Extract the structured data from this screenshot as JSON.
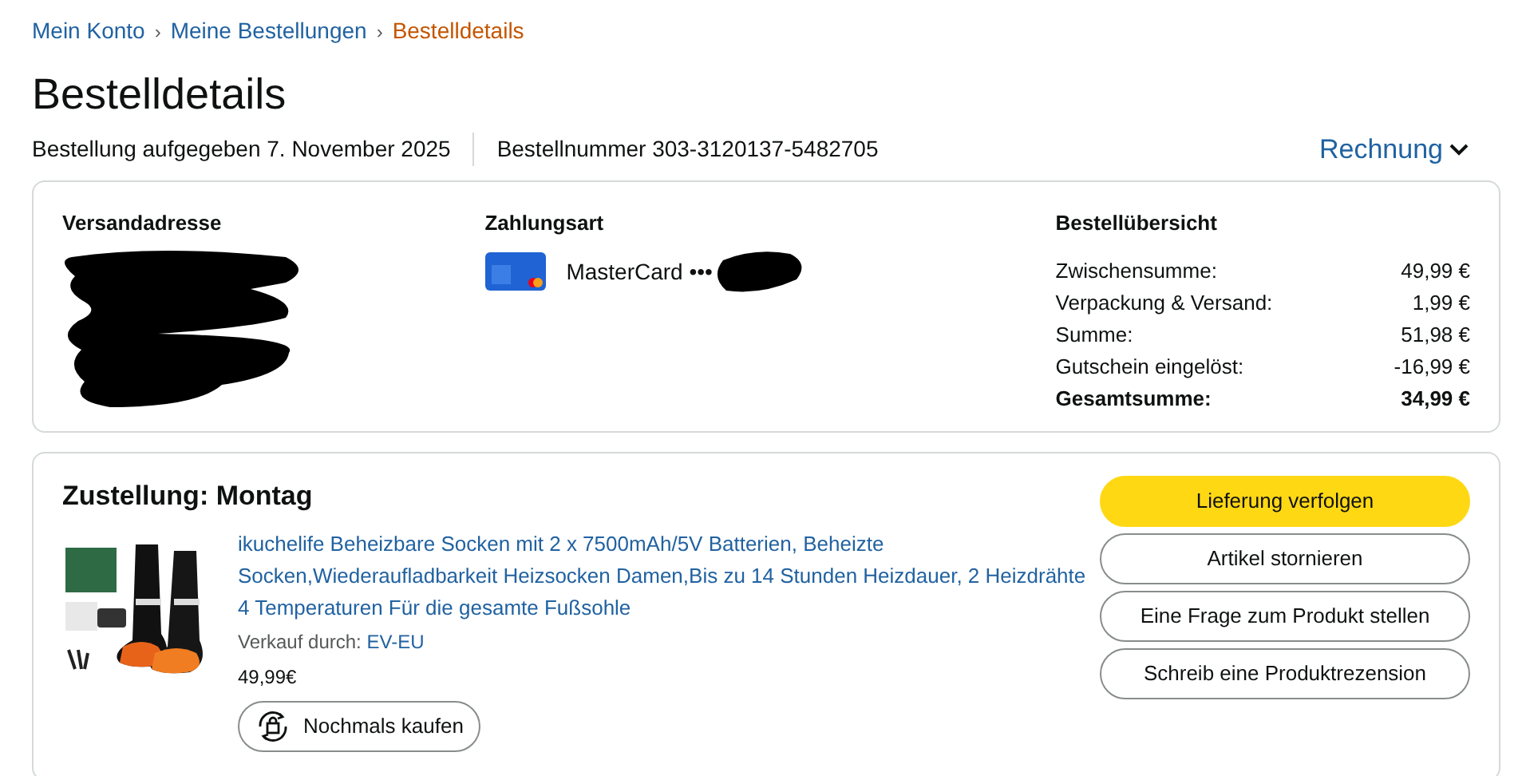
{
  "breadcrumb": [
    {
      "label": "Mein Konto",
      "selected": false
    },
    {
      "separator": "›",
      "label": "Meine Bestellungen",
      "selected": false
    },
    {
      "separator": "›",
      "label": "Bestelldetails",
      "selected": true
    }
  ],
  "title": "Bestelldetails",
  "order_info": [
    "Bestellung aufgegeben 7. November 2025",
    "Bestellnummer 303-3120137-5482705"
  ],
  "invoice_link": "Rechnung",
  "shipping": {
    "heading": "Versandadresse"
  },
  "payment": {
    "heading": "Zahlungsart",
    "card": "MasterCard •••"
  },
  "summary": {
    "heading": "Bestellübersicht",
    "rows": [
      {
        "label": "Zwischensumme:",
        "value": "49,99 €",
        "total": false
      },
      {
        "label": "Verpackung & Versand:",
        "value": "1,99 €",
        "total": false
      },
      {
        "label": "Summe:",
        "value": "51,98 €",
        "total": false
      },
      {
        "label": "Gutschein eingelöst:",
        "value": "-16,99 €",
        "total": false
      },
      {
        "label": "Gesamtsumme:",
        "value": "34,99 €",
        "total": true
      }
    ]
  },
  "delivery": {
    "heading": "Zustellung: Montag",
    "product": {
      "title": "ikuchelife Beheizbare Socken mit 2 x 7500mAh/5V Batterien, Beheizte Socken,Wiederaufladbarkeit Heizsocken Damen,Bis zu 14 Stunden Heizdauer, 2 Heizdrähte 4 Temperaturen Für die gesamte Fußsohle",
      "seller_label": "Verkauf durch:",
      "seller": "EV-EU",
      "price": "49,99€",
      "rebuy": "Nochmals kaufen"
    },
    "actions": [
      {
        "label": "Lieferung verfolgen",
        "kind": "primary"
      },
      {
        "label": "Artikel stornieren",
        "kind": "secondary"
      },
      {
        "label": "Eine Frage zum Produkt stellen",
        "kind": "secondary"
      },
      {
        "label": "Schreib eine Produktrezension",
        "kind": "secondary"
      }
    ]
  }
}
